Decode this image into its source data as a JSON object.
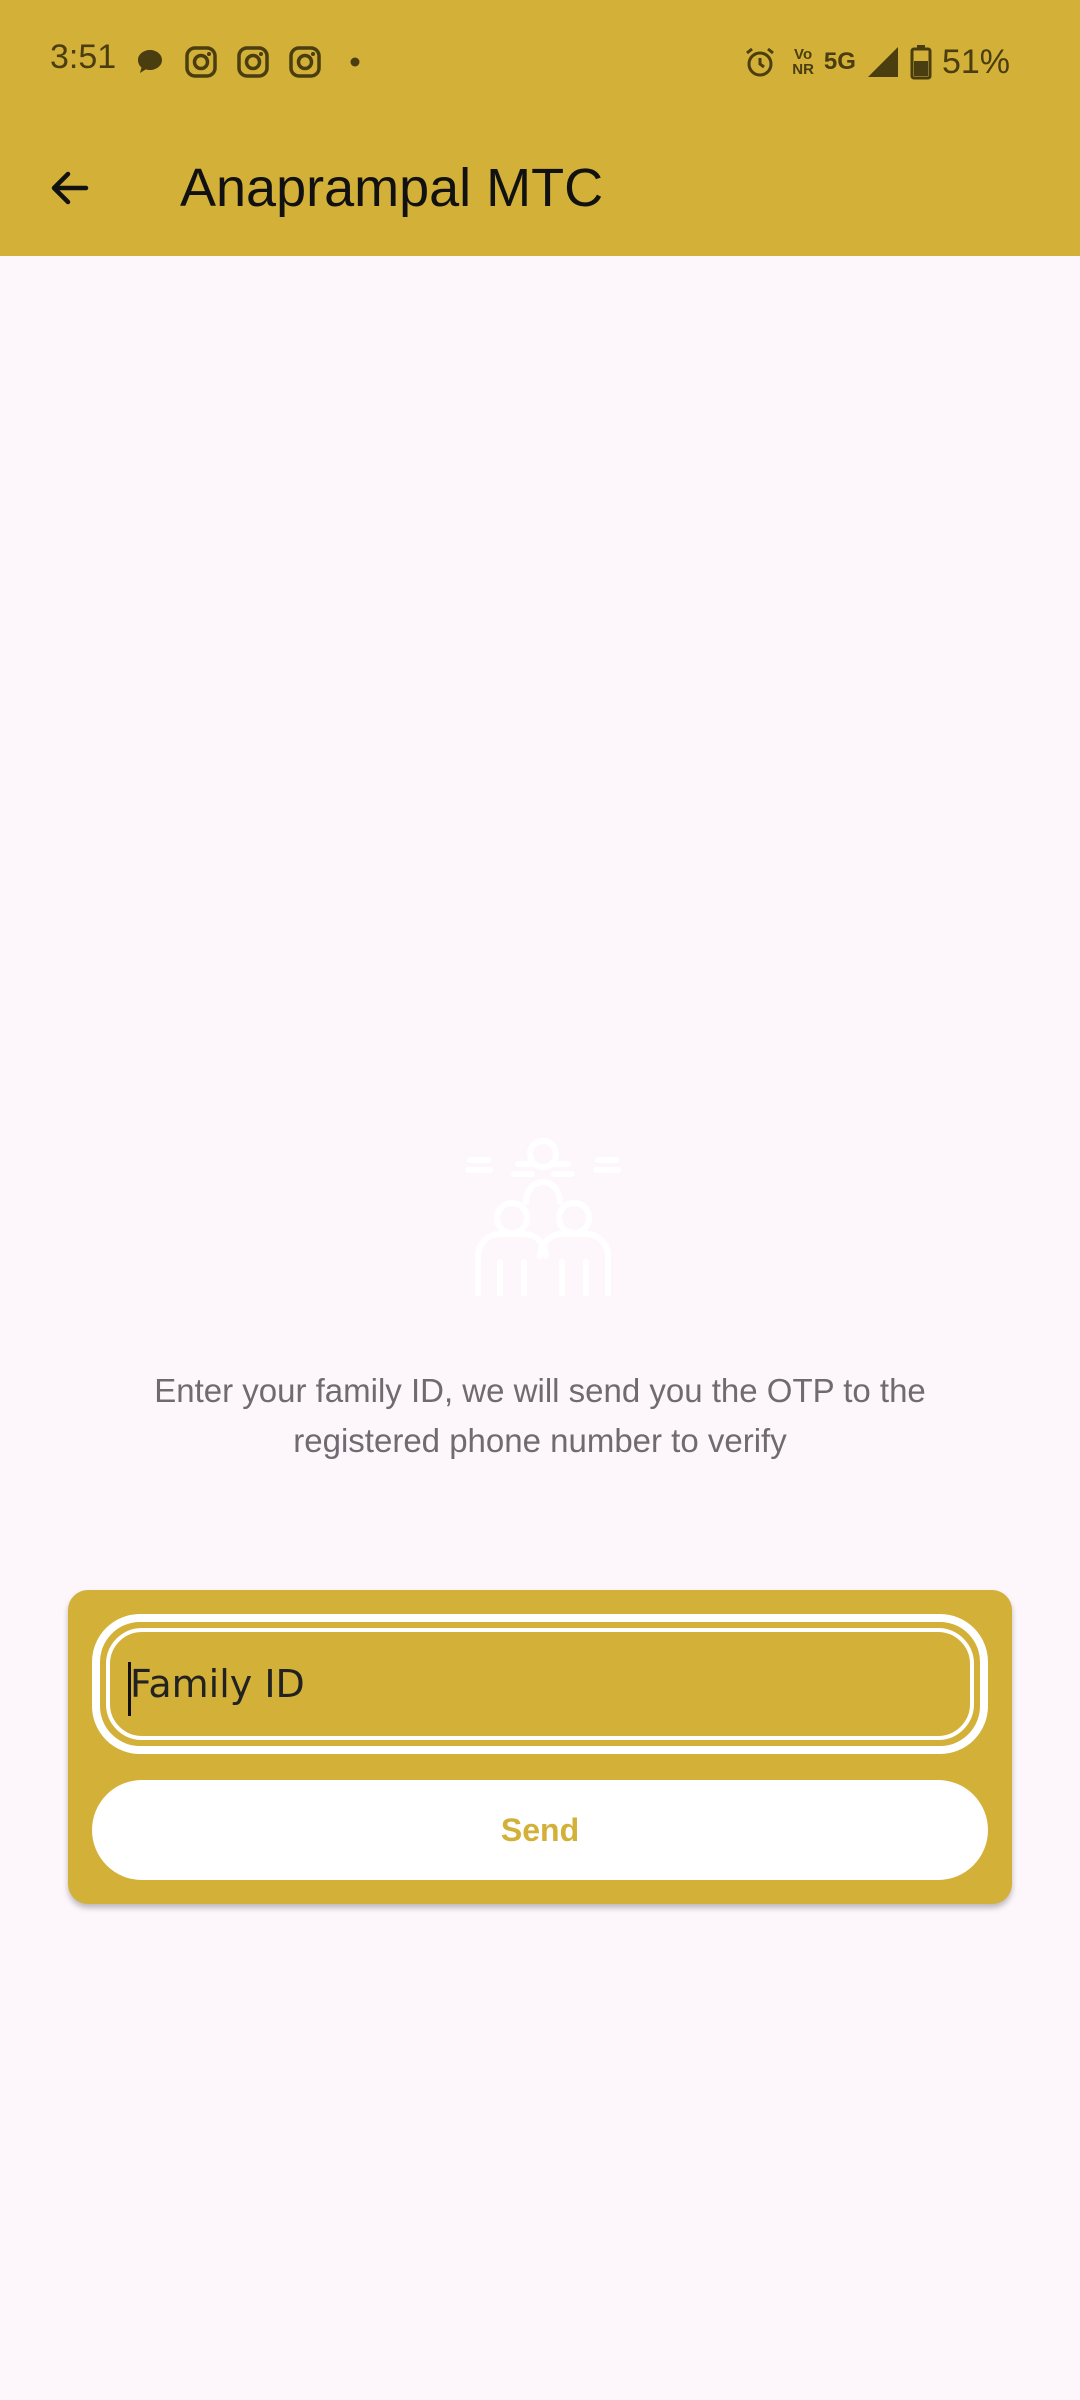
{
  "colors": {
    "primary": "#d3b037",
    "background": "#fdf7fc",
    "surface": "#ffffff"
  },
  "status_bar": {
    "time": "3:51",
    "left_icons": [
      "chat-bubble-icon",
      "instagram-icon",
      "instagram-icon",
      "instagram-icon",
      "dot-icon"
    ],
    "right_icons": [
      "alarm-icon",
      "volte-icon",
      "5g-icon",
      "signal-icon",
      "battery-icon"
    ],
    "vo_label": "Vo",
    "nr_label": "NR",
    "network": "5G",
    "battery": "51%"
  },
  "appbar": {
    "back_icon": "arrow-left-icon",
    "title": "Anaprampal MTC"
  },
  "hero": {
    "icon": "family-group-icon"
  },
  "main": {
    "description": "Enter your family ID, we will send you the OTP to the registered phone number to verify"
  },
  "form": {
    "family_id_placeholder": "Family ID",
    "family_id_value": "",
    "send_label": "Send"
  }
}
